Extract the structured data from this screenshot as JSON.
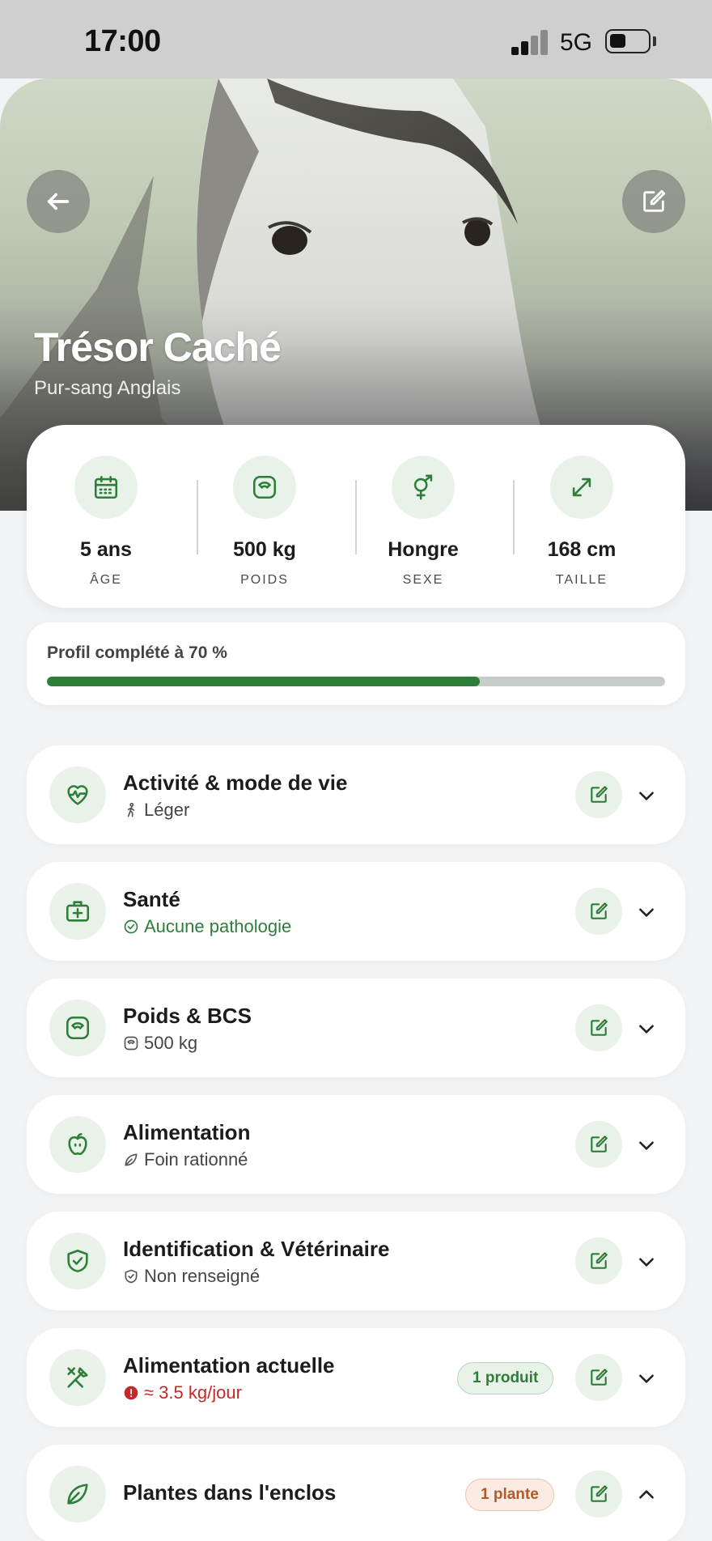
{
  "status": {
    "time": "17:00",
    "network": "5G"
  },
  "horse": {
    "name": "Trésor Caché",
    "breed": "Pur-sang Anglais"
  },
  "stats": [
    {
      "value": "5 ans",
      "label": "ÂGE",
      "icon": "calendar-icon"
    },
    {
      "value": "500 kg",
      "label": "POIDS",
      "icon": "scale-icon"
    },
    {
      "value": "Hongre",
      "label": "SEXE",
      "icon": "gender-icon"
    },
    {
      "value": "168 cm",
      "label": "TAILLE",
      "icon": "expand-arrows-icon"
    }
  ],
  "profile": {
    "label": "Profil complété à 70 %",
    "progress_fraction": 0.7
  },
  "sections": [
    {
      "title": "Activité & mode de vie",
      "subtitle": "Léger",
      "icon": "heart-pulse-icon",
      "sub_icon": "walking-icon",
      "expanded": false
    },
    {
      "title": "Santé",
      "subtitle": "Aucune pathologie",
      "icon": "medical-kit-icon",
      "sub_icon": "check-circle-icon",
      "expanded": false
    },
    {
      "title": "Poids & BCS",
      "subtitle": "500 kg",
      "icon": "scale-icon",
      "sub_icon": "scale-icon",
      "expanded": false
    },
    {
      "title": "Alimentation",
      "subtitle": "Foin rationné",
      "icon": "apple-icon",
      "sub_icon": "leaf-icon",
      "expanded": false
    },
    {
      "title": "Identification & Vétérinaire",
      "subtitle": "Non renseigné",
      "icon": "shield-check-icon",
      "sub_icon": "shield-check-icon",
      "expanded": false
    },
    {
      "title": "Alimentation actuelle",
      "subtitle": "≈ 3.5 kg/jour",
      "badge": "1 produit",
      "icon": "utensils-icon",
      "sub_icon": "alert-icon",
      "expanded": false
    },
    {
      "title": "Plantes dans l'enclos",
      "badge": "1 plante",
      "icon": "leaf-icon",
      "expanded": true
    }
  ],
  "colors": {
    "accent": "#2e7d3a",
    "accent_light": "#e8f2e8",
    "warning": "#c6282a",
    "badge_orange": "#b35a2a"
  }
}
